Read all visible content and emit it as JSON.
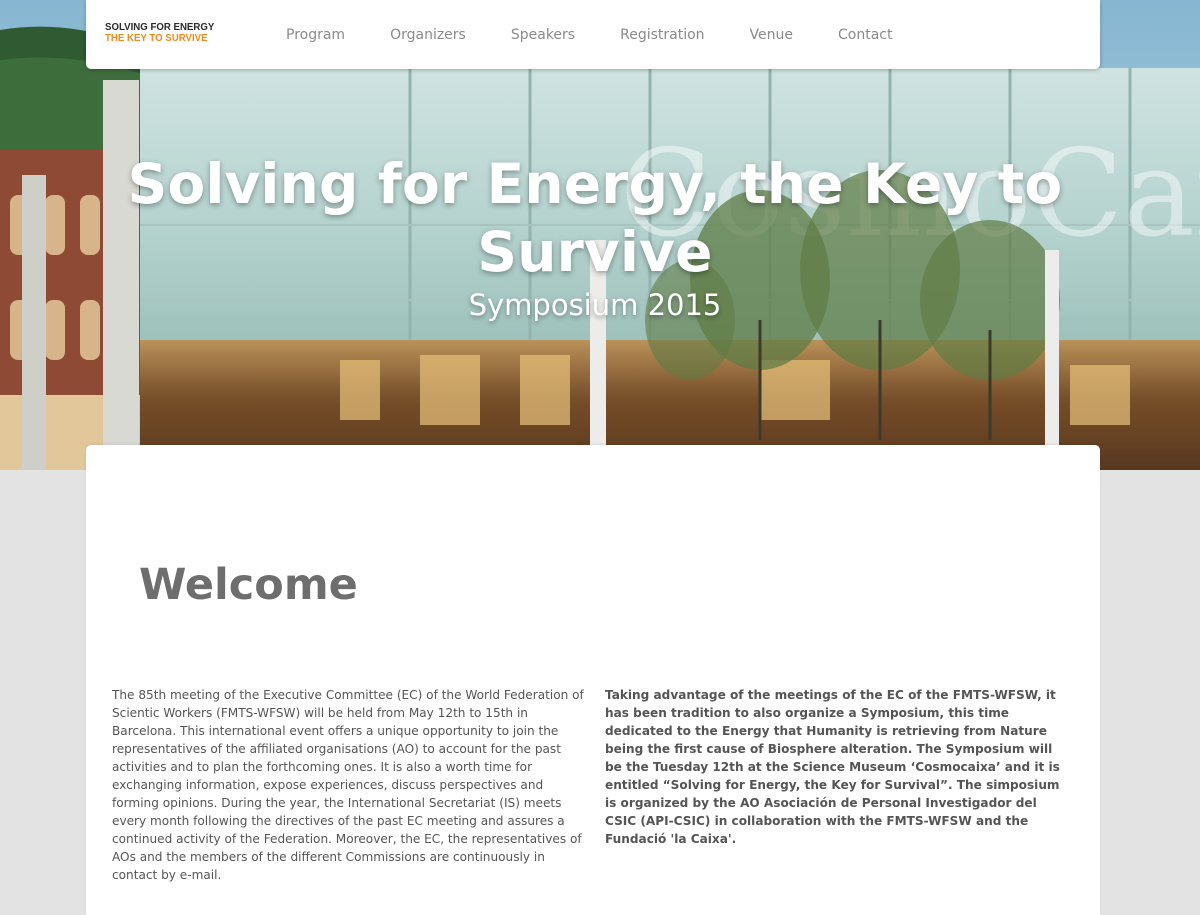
{
  "nav": {
    "logo_line1": "SOLVING FOR ENERGY",
    "logo_line2": "THE KEY TO SURVIVE",
    "links": [
      "Program",
      "Organizers",
      "Speakers",
      "Registration",
      "Venue",
      "Contact"
    ]
  },
  "hero": {
    "title": "Solving for Energy, the Key to Survive",
    "subtitle": "Symposium 2015",
    "building_sign": "CosmoCaixa"
  },
  "main": {
    "heading": "Welcome",
    "left_paragraph": "The 85th meeting of the Executive Committee (EC) of the World Federation of Scientic Workers (FMTS-WFSW) will be held from May 12th to 15th in Barcelona. This international event offers a unique opportunity to join the representatives of the affiliated organisations (AO) to account for the past activities and to plan the forthcoming ones. It is also a worth time for exchanging information, expose experiences, discuss perspectives and forming opinions. During the year, the International Secretariat (IS) meets every month following the directives of the past EC meeting and assures a continued activity of the Federation. Moreover, the EC, the representatives of AOs and the members of the different Commissions are continuously in contact by e-mail.",
    "right_paragraph": "Taking advantage of the meetings of the EC of the FMTS-WFSW, it has been tradition to also organize a Symposium, this time dedicated to the Energy that Humanity is retrieving from Nature being the first cause of Biosphere alteration. The Symposium will be the Tuesday 12th at the Science Museum ‘Cosmocaixa’ and it is entitled “Solving for Energy, the Key for Survival”. The simposium is organized by the AO Asociación de Personal Investigador del CSIC (API-CSIC) in collaboration with the FMTS-WFSW and the Fundació 'la Caixa'."
  },
  "colors": {
    "accent": "#f08a1c",
    "nav_text": "#8a8a8a",
    "heading": "#6e6e6e",
    "body_text": "#555555",
    "page_bg": "#e3e3e3"
  }
}
